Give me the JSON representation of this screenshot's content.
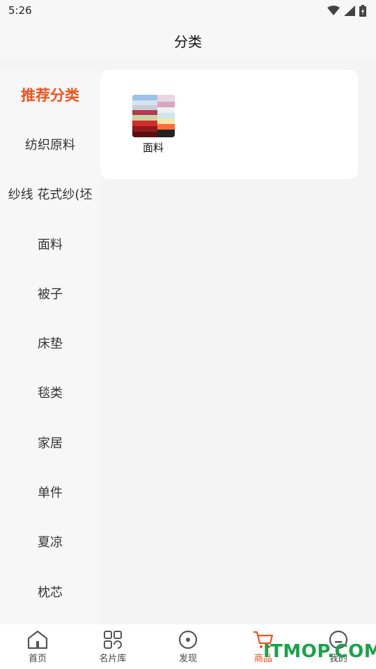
{
  "status_bar": {
    "time": "5:26"
  },
  "header": {
    "title": "分类"
  },
  "sidebar": {
    "items": [
      {
        "label": "推荐分类"
      },
      {
        "label": "纺织原料"
      },
      {
        "label": "纱线 花式纱(坯"
      },
      {
        "label": "面料"
      },
      {
        "label": "被子"
      },
      {
        "label": "床垫"
      },
      {
        "label": "毯类"
      },
      {
        "label": "家居"
      },
      {
        "label": "单件"
      },
      {
        "label": "夏凉"
      },
      {
        "label": "枕芯"
      }
    ]
  },
  "content": {
    "categories": [
      {
        "label": "面料"
      }
    ]
  },
  "tab_bar": {
    "tabs": [
      {
        "label": "首页",
        "icon": "home-icon"
      },
      {
        "label": "名片库",
        "icon": "grid-icon"
      },
      {
        "label": "发现",
        "icon": "compass-icon"
      },
      {
        "label": "商品",
        "icon": "cart-icon"
      },
      {
        "label": "我的",
        "icon": "profile-icon"
      }
    ]
  },
  "watermark": {
    "text": "ITMOP.COM"
  },
  "colors": {
    "accent": "#f0521d",
    "watermark": "#1aa34a"
  }
}
